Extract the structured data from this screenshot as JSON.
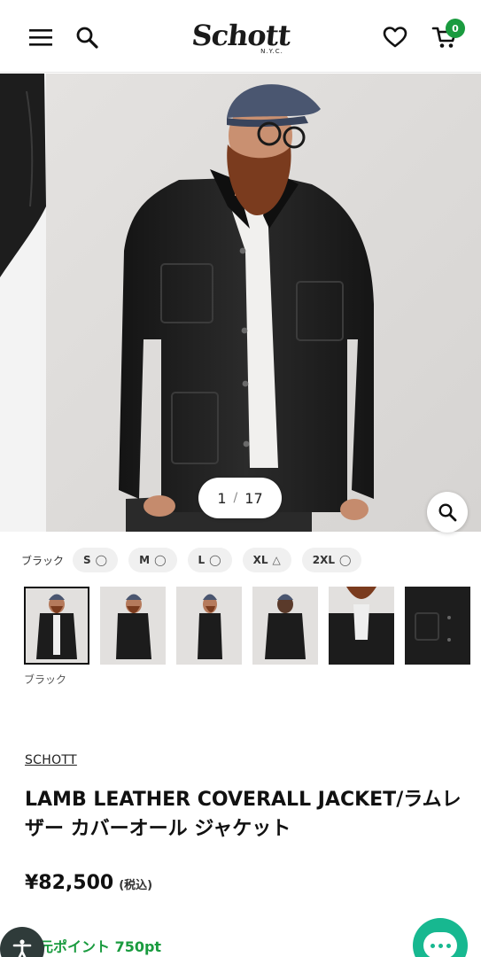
{
  "header": {
    "logo_text": "Schott",
    "logo_sub": "N.Y.C.",
    "cart_count": "0",
    "menu_icon": "menu-icon",
    "search_icon": "search-icon",
    "wishlist_icon": "heart-icon",
    "cart_icon": "cart-icon"
  },
  "gallery": {
    "current": "1",
    "separator": "/",
    "total": "17",
    "zoom_icon": "zoom-icon"
  },
  "variant": {
    "color_label": "ブラック",
    "sizes": [
      {
        "label": "S",
        "mark": "◯"
      },
      {
        "label": "M",
        "mark": "◯"
      },
      {
        "label": "L",
        "mark": "◯"
      },
      {
        "label": "XL",
        "mark": "△"
      },
      {
        "label": "2XL",
        "mark": "◯"
      }
    ],
    "selected_color_caption": "ブラック"
  },
  "product": {
    "brand": "SCHOTT",
    "title": "LAMB LEATHER COVERALL JACKET/ラムレザー カバーオール ジャケット",
    "price": "¥82,500",
    "tax_note": "(税込)",
    "points": "元ポイント 750pt"
  },
  "colors": {
    "accent_green": "#1a9b3f",
    "chat_teal": "#17b890"
  }
}
